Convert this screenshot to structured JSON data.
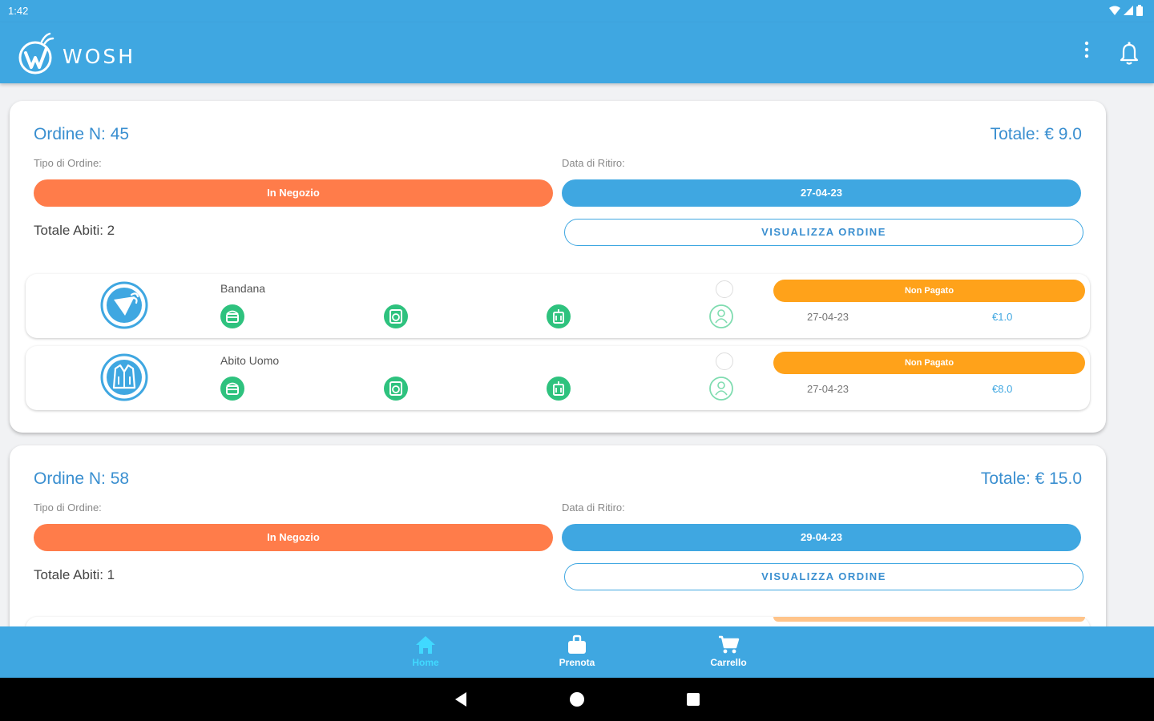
{
  "status_bar": {
    "time": "1:42",
    "icons": [
      "wifi-icon",
      "signal-icon",
      "battery-icon"
    ]
  },
  "app_bar": {
    "brand": "WOSH",
    "actions": [
      "more-vert-icon",
      "bell-icon"
    ]
  },
  "orders": [
    {
      "title": "Ordine N: 45",
      "total": "Totale: € 9.0",
      "type_label": "Tipo di Ordine:",
      "type_value": "In Negozio",
      "date_label": "Data di Ritiro:",
      "date_value": "27-04-23",
      "items_count": "Totale Abiti: 2",
      "view_button": "VISUALIZZA ORDINE",
      "items": [
        {
          "name": "Bandana",
          "icon": "bandana-icon",
          "payment": "Non Pagato",
          "date": "27-04-23",
          "price": "€1.0"
        },
        {
          "name": "Abito Uomo",
          "icon": "suit-icon",
          "payment": "Non Pagato",
          "date": "27-04-23",
          "price": "€8.0"
        }
      ]
    },
    {
      "title": "Ordine N: 58",
      "total": "Totale: € 15.0",
      "type_label": "Tipo di Ordine:",
      "type_value": "In Negozio",
      "date_label": "Data di Ritiro:",
      "date_value": "29-04-23",
      "items_count": "Totale Abiti: 1",
      "view_button": "VISUALIZZA ORDINE"
    }
  ],
  "item_steps": [
    "basket-icon",
    "washing-machine-icon",
    "garment-bag-icon",
    "person-pickup-icon"
  ],
  "bottom_nav": [
    {
      "label": "Home",
      "icon": "home-icon",
      "active": true
    },
    {
      "label": "Prenota",
      "icon": "briefcase-icon",
      "active": false
    },
    {
      "label": "Carrello",
      "icon": "cart-icon",
      "active": false
    }
  ],
  "colors": {
    "primary": "#3fa7e1",
    "order_type": "#ff7c4a",
    "unpaid": "#ffa21a",
    "step_done": "#2ec27e",
    "active_nav": "#40d9ff",
    "background": "#f1f2f4"
  }
}
